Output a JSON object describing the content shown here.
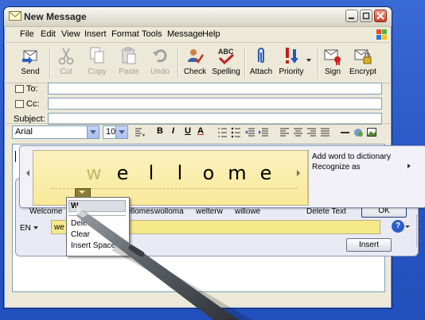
{
  "window": {
    "title": "New Message",
    "title_icon": "envelope-icon"
  },
  "menu": [
    "File",
    "Edit",
    "View",
    "Insert",
    "Format",
    "Tools",
    "Message",
    "Help"
  ],
  "toolbar": {
    "send": "Send",
    "cut": "Cut",
    "copy": "Copy",
    "paste": "Paste",
    "undo": "Undo",
    "check": "Check",
    "spelling": "Spelling",
    "attach": "Attach",
    "priority": "Priority",
    "sign": "Sign",
    "encrypt": "Encrypt"
  },
  "headers": {
    "to_label": "To:",
    "cc_label": "Cc:",
    "subject_label": "Subject:",
    "to_value": "",
    "cc_value": "",
    "subject_value": ""
  },
  "format": {
    "font": "Arial",
    "size": "10",
    "bold": "B",
    "italic": "I",
    "underline": "U",
    "fontcolor": "A"
  },
  "tip": {
    "letters": [
      "w",
      "e",
      "l",
      "l",
      "o",
      "m",
      "e"
    ],
    "side_add": "Add word to dictionary",
    "side_recognize": "Recognize as",
    "suggestions": [
      "Welcome",
      "wellomes",
      "wolloma",
      "welterw",
      "willowe"
    ],
    "delete_text": "Delete Text",
    "ok": "OK",
    "lang": "EN",
    "input_value": "we",
    "help": "?",
    "insert": "Insert"
  },
  "popup": {
    "top": "W",
    "items": [
      "Delete",
      "Clear",
      "Insert Space"
    ]
  },
  "colors": {
    "desktop": "#2754c2",
    "write_area": "#f9e99a",
    "close_button": "#c8402a"
  }
}
